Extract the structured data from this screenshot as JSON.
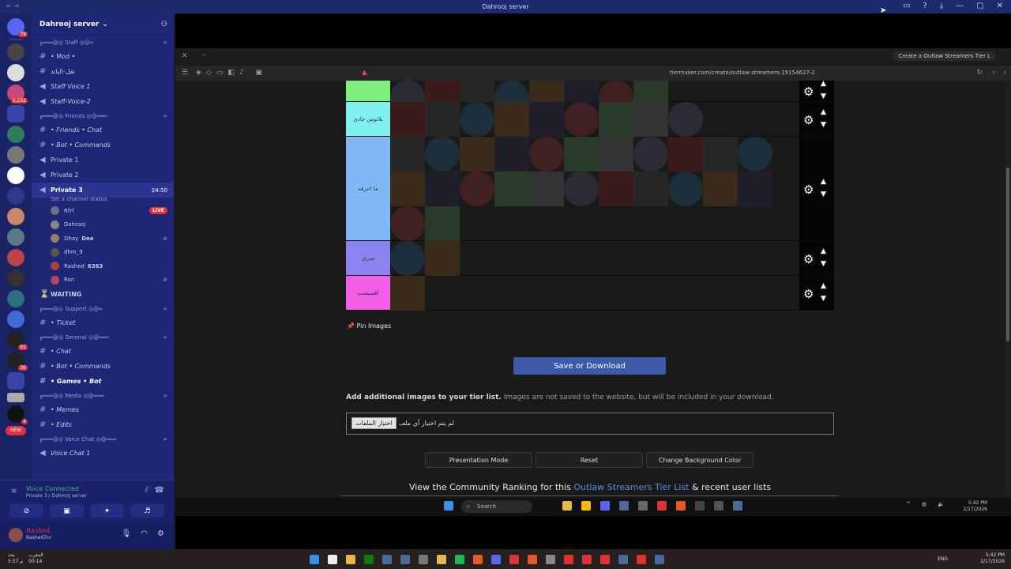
{
  "window": {
    "title": "Dahrooj server"
  },
  "server": {
    "name": "Dahrooj server",
    "badges": [
      "79",
      "5,252",
      "91",
      "36",
      "NEW",
      "4"
    ]
  },
  "channels": {
    "staff_category": "╔═══@◎ Staff ◎@═",
    "mod": "• Mod •",
    "staff_text": "نقل-الباند",
    "staff_voice_1": "Staff Voice 1",
    "staff_voice_2": "Staff-Voice-2",
    "friends_category": "╔═══@◎ Friends ◎@═══",
    "friends_chat": "• Friends • Chat",
    "bot_commands": "• Bot • Commands",
    "private1": "Private 1",
    "private2": "Private 2",
    "private3": "Private 3",
    "private3_time": "24:50",
    "set_status": "Set a channel status",
    "voice_users": [
      {
        "name": "Rfrf",
        "live": "LIVE"
      },
      {
        "name": "Dahrooj"
      },
      {
        "name": "Dhay",
        "tag": "Dee"
      },
      {
        "name": "dhm_9"
      },
      {
        "name": "Rashed",
        "tag": "6363"
      },
      {
        "name": "Ron"
      }
    ],
    "waiting": "WAITING",
    "support_category": "╔═══@◎ Support ◎@═",
    "ticket": "• Ticket",
    "general_category": "╔═══@◎ General ◎@═══",
    "chat": "• Chat",
    "bot_commands2": "• Bot • Commands",
    "games_bot": "• Games • Bot",
    "media_category": "╔═══@◎ Media ◎@═══",
    "memes": "• Memes",
    "edits": "• Edits",
    "voicechat_category": "╔═══@◎ Voice Chat ◎@═══",
    "voice_chat_1": "Voice Chat 1"
  },
  "voice": {
    "status": "Voice Connected",
    "location": "Private 3 / Dahrooj server"
  },
  "user": {
    "name": "Rashed",
    "status": "Rashed7cr"
  },
  "browser": {
    "tab_title": "Create a Outlaw Streamers Tier L",
    "url": "tiermaker.com/create/outlaw-streamers-19154627-2"
  },
  "tiers": [
    {
      "label": "",
      "color": "#7fef7f",
      "count": 8
    },
    {
      "label": "بلاتوس جادي",
      "color": "#7ff2ef",
      "count": 9
    },
    {
      "label": "ما اعرفه",
      "color": "#7fb8f5",
      "count": 24
    },
    {
      "label": "مدري",
      "color": "#8b84f0",
      "count": 2
    },
    {
      "label": "أفسيسب",
      "color": "#f25ee6",
      "count": 1
    }
  ],
  "page": {
    "pin_images": "Pin Images",
    "save_button": "Save or Download",
    "add_images_bold": "Add additional images to your tier list.",
    "add_images_rest": " Images are not saved to the website, but will be included in your download.",
    "choose_files": "اختيار الملفات",
    "no_file": "لم يتم اختيار أي ملف",
    "presentation_mode": "Presentation Mode",
    "reset": "Reset",
    "change_bg": "Change Background Color",
    "community_pre": "View the Community Ranking for this ",
    "community_link": "Outlaw Streamers Tier List",
    "community_post": " & recent user lists"
  },
  "inner_taskbar": {
    "search": "Search",
    "lang": "ENG",
    "time": "5:42 PM",
    "date": "2/17/2026"
  },
  "outer_taskbar": {
    "weather_line1": "يجد",
    "weather_line2": "5:57 م",
    "prayer_line1": "المغرب",
    "prayer_line2": "00:14",
    "lang": "ENG",
    "time": "5:42 PM",
    "date": "2/17/2026"
  }
}
